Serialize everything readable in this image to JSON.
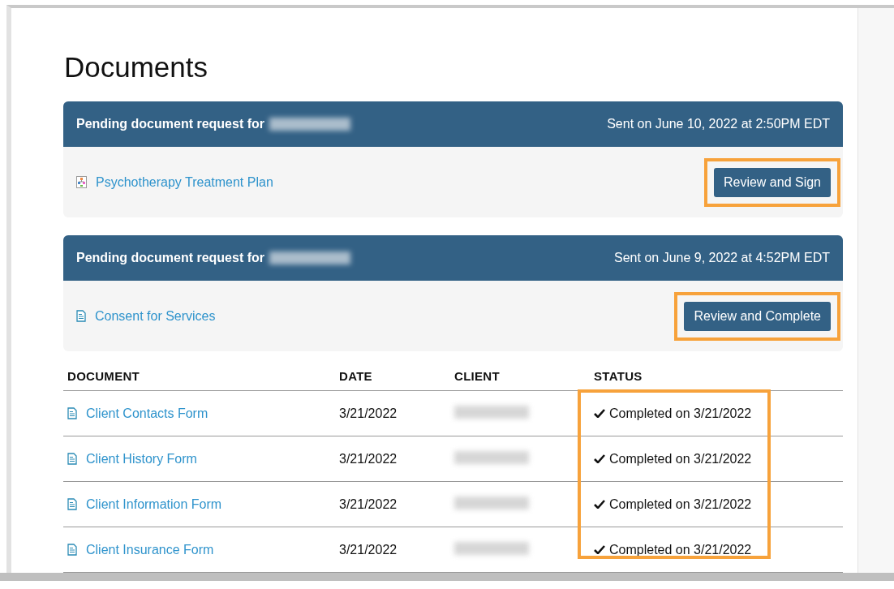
{
  "page": {
    "title": "Documents"
  },
  "requests": [
    {
      "header": "Pending document request for",
      "client_hidden": true,
      "sent": "Sent on June 10, 2022 at 2:50PM EDT",
      "document": {
        "name": "Psychotherapy Treatment Plan",
        "kind": "plan"
      },
      "action": "Review and Sign",
      "highlighted": true
    },
    {
      "header": "Pending document request for",
      "client_hidden": true,
      "sent": "Sent on June 9, 2022 at 4:52PM EDT",
      "document": {
        "name": "Consent for Services",
        "kind": "form"
      },
      "action": "Review and Complete",
      "highlighted": true
    }
  ],
  "table": {
    "columns": [
      "DOCUMENT",
      "DATE",
      "CLIENT",
      "STATUS"
    ],
    "status_highlighted": true,
    "rows": [
      {
        "document": "Client Contacts Form",
        "kind": "form",
        "date": "3/21/2022",
        "client_hidden": true,
        "status": "Completed on 3/21/2022"
      },
      {
        "document": "Client History Form",
        "kind": "form",
        "date": "3/21/2022",
        "client_hidden": true,
        "status": "Completed on 3/21/2022"
      },
      {
        "document": "Client Information Form",
        "kind": "form",
        "date": "3/21/2022",
        "client_hidden": true,
        "status": "Completed on 3/21/2022"
      },
      {
        "document": "Client Insurance Form",
        "kind": "form",
        "date": "3/21/2022",
        "client_hidden": true,
        "status": "Completed on 3/21/2022"
      }
    ]
  }
}
